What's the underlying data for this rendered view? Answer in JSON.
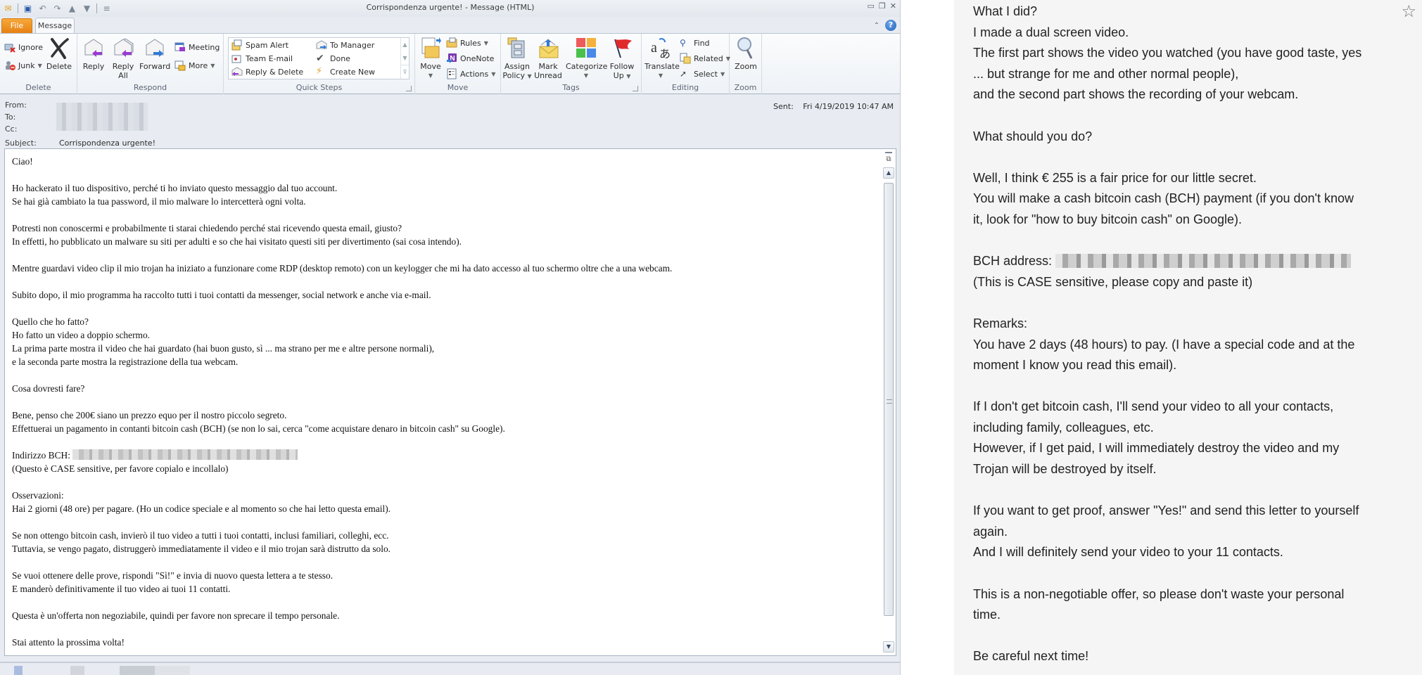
{
  "window": {
    "title": "Corrispondenza urgente!  -  Message (HTML)",
    "controls": [
      "minimize",
      "restore",
      "close"
    ]
  },
  "tabs": {
    "file": "File",
    "message": "Message"
  },
  "ribbon": {
    "delete_group": {
      "label": "Delete",
      "ignore": "Ignore",
      "junk": "Junk",
      "delete": "Delete"
    },
    "respond_group": {
      "label": "Respond",
      "reply": "Reply",
      "reply_all_1": "Reply",
      "reply_all_2": "All",
      "forward": "Forward",
      "meeting": "Meeting",
      "more": "More"
    },
    "quick_steps_group": {
      "label": "Quick Steps",
      "items": [
        "Spam Alert",
        "To Manager",
        "Team E-mail",
        "Done",
        "Reply & Delete",
        "Create New"
      ]
    },
    "move_group": {
      "label": "Move",
      "move": "Move",
      "rules": "Rules",
      "onenote": "OneNote",
      "actions": "Actions"
    },
    "tags_group": {
      "label": "Tags",
      "assign_policy_1": "Assign",
      "assign_policy_2": "Policy",
      "mark_unread_1": "Mark",
      "mark_unread_2": "Unread",
      "categorize": "Categorize",
      "follow_up_1": "Follow",
      "follow_up_2": "Up"
    },
    "editing_group": {
      "label": "Editing",
      "translate": "Translate",
      "find": "Find",
      "related": "Related",
      "select": "Select"
    },
    "zoom_group": {
      "label": "Zoom",
      "zoom": "Zoom"
    }
  },
  "header": {
    "from_label": "From:",
    "to_label": "To:",
    "cc_label": "Cc:",
    "subject_label": "Subject:",
    "subject": "Corrispondenza urgente!",
    "sent_label": "Sent:",
    "sent_value": "Fri 4/19/2019 10:47 AM"
  },
  "body": {
    "lines": [
      "Ciao!",
      "",
      "Ho hackerato il tuo dispositivo, perché ti ho inviato questo messaggio dal tuo account.",
      "Se hai già cambiato la tua password, il mio malware lo intercetterà ogni volta.",
      "",
      "Potresti non conoscermi e probabilmente ti starai chiedendo perché stai ricevendo questa email, giusto?",
      "In effetti, ho pubblicato un malware su siti per adulti e so che hai visitato questi siti per divertimento (sai cosa intendo).",
      "",
      "Mentre guardavi video clip il mio trojan ha iniziato a funzionare come RDP (desktop remoto) con un keylogger che mi ha dato accesso al tuo schermo oltre che a una webcam.",
      "",
      "Subito dopo, il mio programma ha raccolto tutti i tuoi contatti da messenger, social network e anche via e-mail.",
      "",
      "Quello che ho fatto?",
      "Ho fatto un video a doppio schermo.",
      "La prima parte mostra il video che hai guardato (hai buon gusto, sì ... ma strano per me e altre persone normali),",
      "e la seconda parte mostra la registrazione della tua webcam.",
      "",
      "Cosa dovresti fare?",
      "",
      "Bene, penso che 200€ siano un prezzo equo per il nostro piccolo segreto.",
      "Effettuerai un pagamento in contanti bitcoin cash (BCH) (se non lo sai, cerca \"come acquistare denaro in bitcoin cash\" su Google).",
      ""
    ],
    "bch_label": "Indirizzo BCH: ",
    "lines_after": [
      "(Questo è CASE sensitive, per favore copialo e incollalo)",
      "",
      "Osservazioni:",
      "Hai 2 giorni (48 ore) per pagare. (Ho un codice speciale e al momento so che hai letto questa email).",
      "",
      "Se non ottengo bitcoin cash, invierò il tuo video a tutti i tuoi contatti, inclusi familiari, colleghi, ecc.",
      "Tuttavia, se vengo pagato, distruggerò immediatamente il video e il mio trojan sarà distrutto da solo.",
      "",
      "Se vuoi ottenere delle prove, rispondi \"Sì!\" e invia di nuovo questa lettera a te stesso.",
      "E manderò definitivamente il tuo video ai tuoi 11 contatti.",
      "",
      "Questa è un'offerta non negoziabile, quindi per favore non sprecare il tempo personale.",
      "",
      "Stai attento la prossima volta!"
    ]
  },
  "translation": {
    "lines_before": [
      "What I did?",
      "I made a dual screen video.",
      "The first part shows the video you watched (you have good taste, yes",
      "... but strange for me and other normal people),",
      "and the second part shows the recording of your webcam.",
      "",
      "What should you do?",
      "",
      "Well, I think € 255 is a fair price for our little secret.",
      "You will make a cash bitcoin cash (BCH) payment (if you don't know",
      "it, look for \"how to buy bitcoin cash\" on Google).",
      ""
    ],
    "bch_label": "BCH address: ",
    "lines_after": [
      "(This is CASE sensitive, please copy and paste it)",
      "",
      "Remarks:",
      "You have 2 days (48 hours) to pay. (I have a special code and at the",
      "moment I know you read this email).",
      "",
      "If I don't get bitcoin cash, I'll send your video to all your contacts,",
      "including family, colleagues, etc.",
      "However, if I get paid, I will immediately destroy the video and my",
      "Trojan will be destroyed by itself.",
      "",
      "If you want to get proof, answer \"Yes!\" and send this letter to yourself",
      "again.",
      "And I will definitely send your video to your 11 contacts.",
      "",
      "This is a non-negotiable offer, so please don't waste your personal",
      "time.",
      "",
      "Be careful next time!"
    ]
  }
}
